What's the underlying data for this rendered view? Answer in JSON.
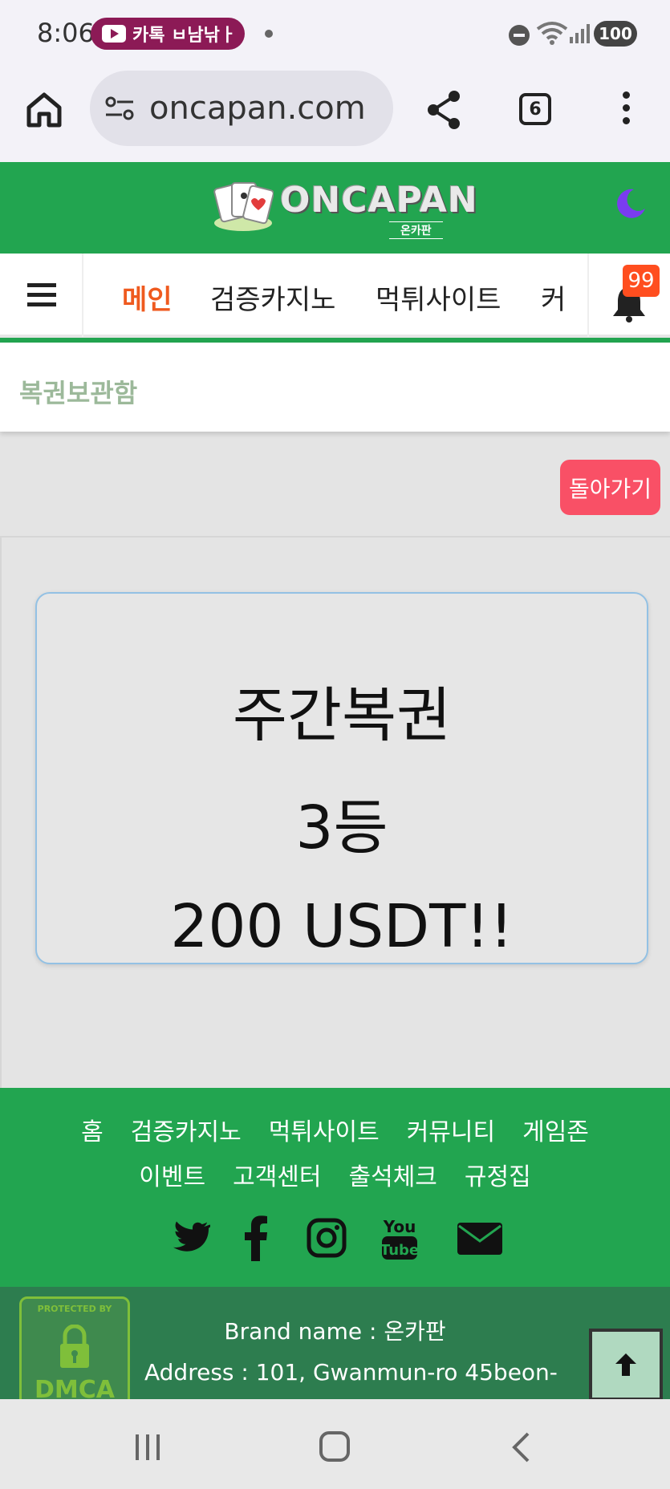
{
  "status_bar": {
    "time": "8:06",
    "notification_text": "카톡 ㅂ남낚ㅏ",
    "battery": "100"
  },
  "browser": {
    "url": "oncapan.com",
    "tab_count": "6"
  },
  "site": {
    "logo_text": "ONCAPAN",
    "logo_subtext": "온카판"
  },
  "nav": {
    "items": [
      {
        "label": "메인",
        "active": true
      },
      {
        "label": "검증카지노",
        "active": false
      },
      {
        "label": "먹튀사이트",
        "active": false
      },
      {
        "label": "커",
        "active": false
      }
    ],
    "notification_badge": "99"
  },
  "page": {
    "title": "복권보관함",
    "back_label": "돌아가기"
  },
  "lottery_card": {
    "name": "주간복권",
    "rank": "3등",
    "prize": "200 USDT!!"
  },
  "footer": {
    "links_row1": [
      "홈",
      "검증카지노",
      "먹튀사이트",
      "커뮤니티",
      "게임존"
    ],
    "links_row2": [
      "이벤트",
      "고객센터",
      "출석체크",
      "규정집"
    ],
    "social_icons": [
      "twitter-icon",
      "facebook-icon",
      "instagram-icon",
      "youtube-icon",
      "email-icon"
    ],
    "brand_line": "Brand name : 온카판",
    "address_line": "Address : 101, Gwanmun-ro 45beon-",
    "dmca_top": "PROTECTED BY",
    "dmca_text": "DMCA"
  },
  "colors": {
    "brand_green": "#22a550",
    "active_nav": "#ef5a1f",
    "back_button": "#f95066",
    "badge": "#ff4e1f"
  }
}
